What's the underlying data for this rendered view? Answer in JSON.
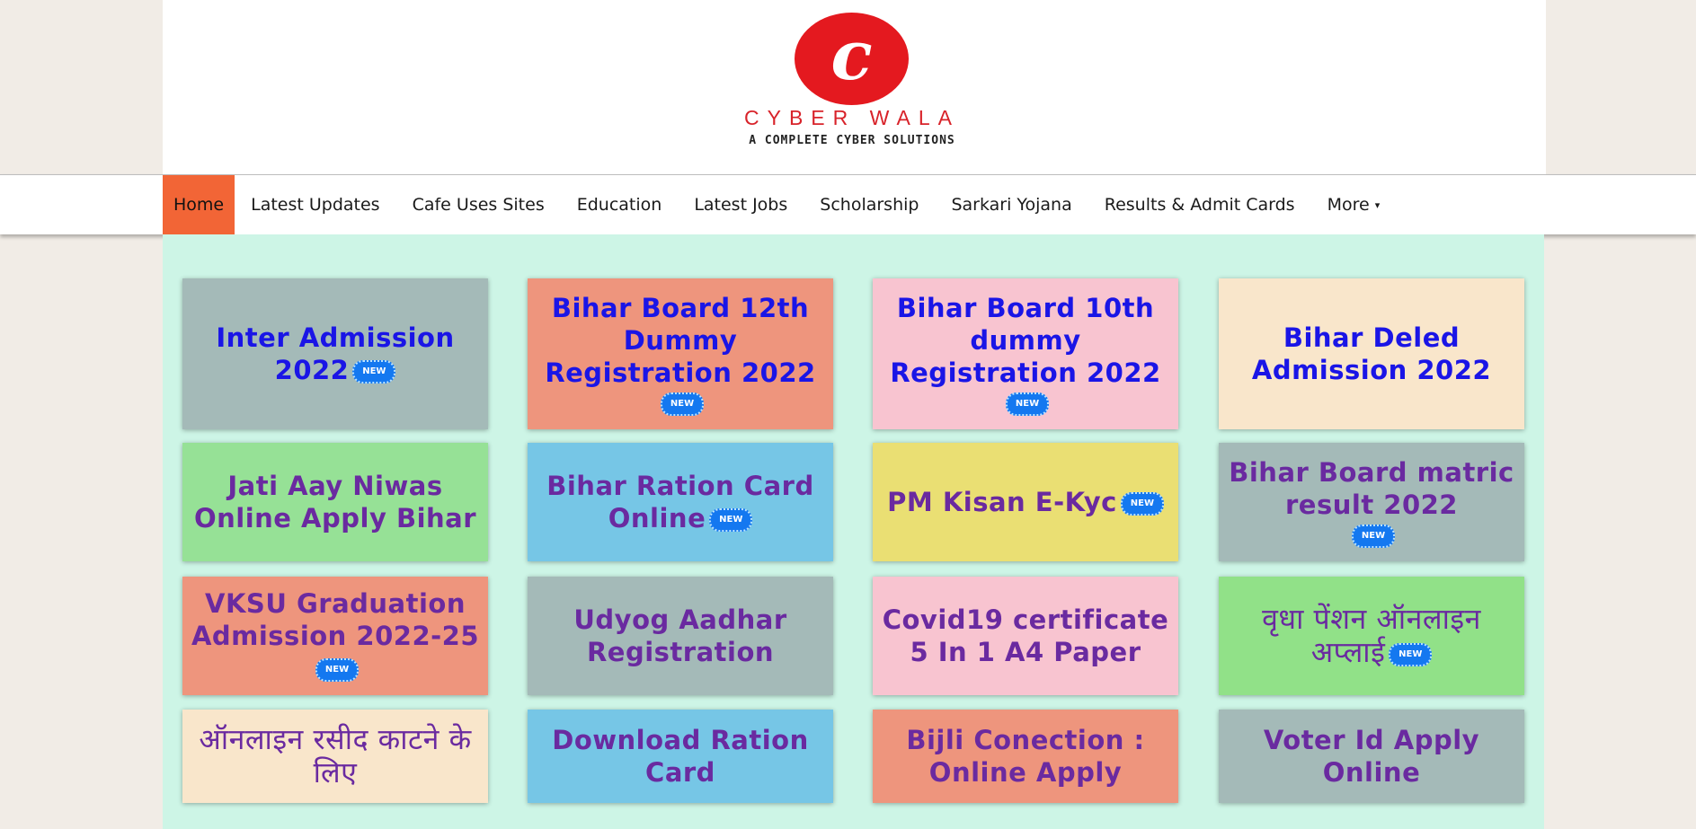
{
  "site": {
    "logo_letter": "c",
    "logo_name": "CYBER WALA",
    "logo_tagline": "A COMPLETE CYBER SOLUTIONS"
  },
  "colors": {
    "logo_red": "#e4191f",
    "nav_active": "#f26536",
    "content_bg": "#cdf5e6",
    "title_blue": "#1a15e6",
    "title_purple": "#6a2aa0"
  },
  "nav": {
    "items": [
      {
        "label": "Home",
        "active": true
      },
      {
        "label": "Latest Updates"
      },
      {
        "label": "Cafe Uses Sites"
      },
      {
        "label": "Education"
      },
      {
        "label": "Latest Jobs"
      },
      {
        "label": "Scholarship"
      },
      {
        "label": "Sarkari Yojana"
      },
      {
        "label": "Results & Admit Cards"
      },
      {
        "label": "More",
        "icon": "caret-down-icon",
        "caret": "▾"
      }
    ]
  },
  "badge_text": "NEW",
  "cards": [
    {
      "title": "Inter Admission 2022",
      "new": true,
      "color": "#a4bab8"
    },
    {
      "title": "Bihar Board 12th Dummy Registration 2022",
      "new": true,
      "color": "#ee957d"
    },
    {
      "title": "Bihar Board 10th dummy Registration 2022",
      "new": true,
      "color": "#f8c4d0"
    },
    {
      "title": "Bihar Deled Admission 2022",
      "new": false,
      "color": "#f9e6cb"
    },
    {
      "title": "Jati Aay Niwas Online Apply Bihar",
      "new": false,
      "color": "#96e196"
    },
    {
      "title": "Bihar Ration Card Online",
      "new": true,
      "color": "#76c6e6"
    },
    {
      "title": "PM Kisan E-Kyc",
      "new": true,
      "color": "#eadf73"
    },
    {
      "title": "Bihar Board matric result 2022",
      "new": true,
      "color": "#a4bab8"
    },
    {
      "title": "VKSU Graduation Admission 2022-25",
      "new": true,
      "color": "#ee957d"
    },
    {
      "title": "Udyog Aadhar Registration",
      "new": false,
      "color": "#a4bab8"
    },
    {
      "title": "Covid19 certificate 5 In 1 A4 Paper",
      "new": false,
      "color": "#f8c4d0"
    },
    {
      "title": "वृधा पेंशन ऑनलाइन अप्लाई",
      "new": true,
      "color": "#91e188"
    },
    {
      "title": "ऑनलाइन रसीद काटने के लिए",
      "new": false,
      "color": "#f9e6cb"
    },
    {
      "title": "Download Ration Card",
      "new": false,
      "color": "#76c6e6"
    },
    {
      "title": "Bijli Conection : Online Apply",
      "new": false,
      "color": "#ee957d"
    },
    {
      "title": "Voter Id Apply Online",
      "new": false,
      "color": "#a4bab8"
    }
  ]
}
